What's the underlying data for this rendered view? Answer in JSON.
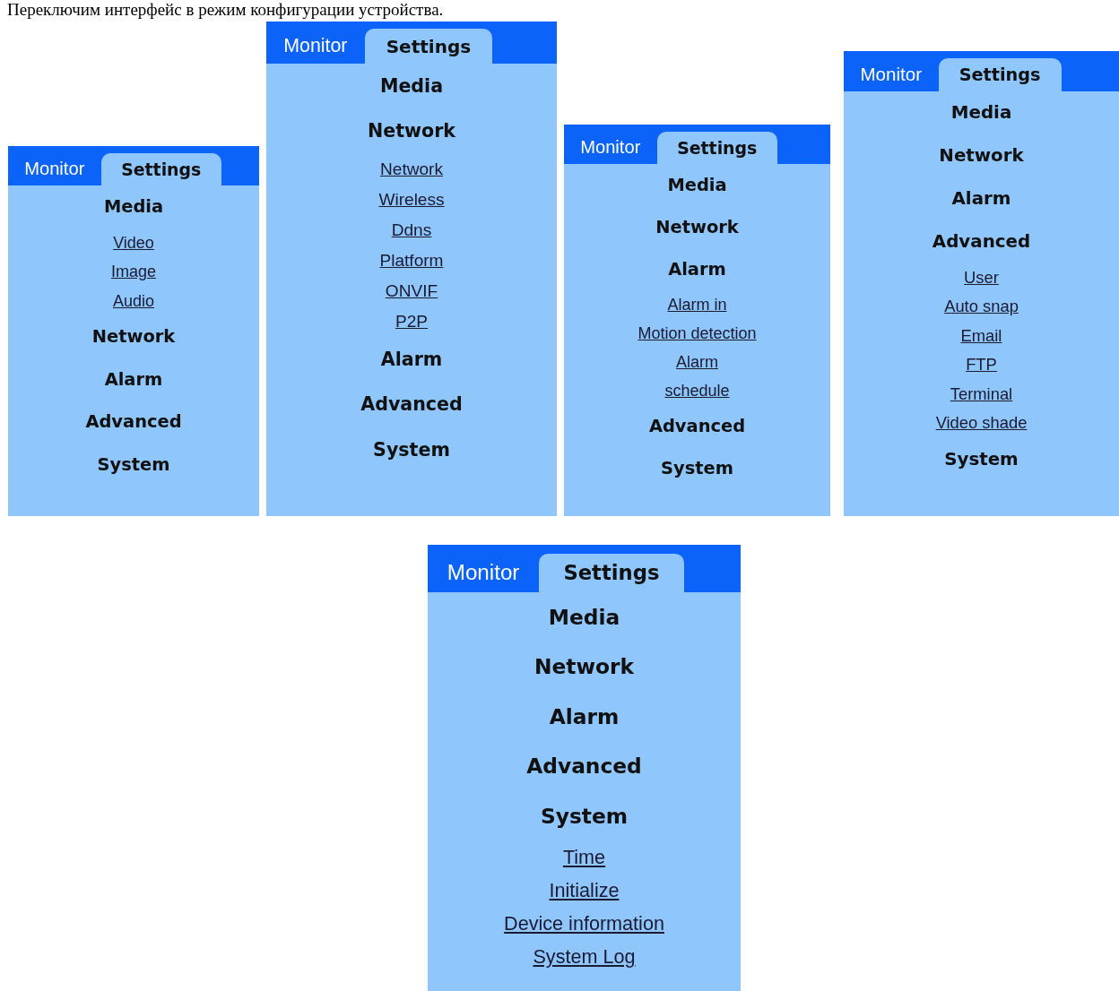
{
  "caption": "Переключим интерфейс в режим конфигурации устройства.",
  "panels": [
    {
      "tabs": [
        {
          "label": "Monitor",
          "selected": false
        },
        {
          "label": "Settings",
          "selected": true
        }
      ],
      "sections": [
        {
          "title": "Media",
          "links": [
            "Video",
            "Image",
            "Audio"
          ]
        },
        {
          "title": "Network"
        },
        {
          "title": "Alarm"
        },
        {
          "title": "Advanced"
        },
        {
          "title": "System"
        }
      ]
    },
    {
      "tabs": [
        {
          "label": "Monitor",
          "selected": false
        },
        {
          "label": "Settings",
          "selected": true
        }
      ],
      "sections": [
        {
          "title": "Media"
        },
        {
          "title": "Network",
          "links": [
            "Network",
            "Wireless",
            "Ddns",
            "Platform",
            "ONVIF",
            "P2P"
          ]
        },
        {
          "title": "Alarm"
        },
        {
          "title": "Advanced"
        },
        {
          "title": "System"
        }
      ]
    },
    {
      "tabs": [
        {
          "label": "Monitor",
          "selected": false
        },
        {
          "label": "Settings",
          "selected": true
        }
      ],
      "sections": [
        {
          "title": "Media"
        },
        {
          "title": "Network"
        },
        {
          "title": "Alarm",
          "links": [
            "Alarm in",
            "Motion detection",
            "Alarm",
            "schedule"
          ]
        },
        {
          "title": "Advanced"
        },
        {
          "title": "System"
        }
      ]
    },
    {
      "tabs": [
        {
          "label": "Monitor",
          "selected": false
        },
        {
          "label": "Settings",
          "selected": true
        }
      ],
      "sections": [
        {
          "title": "Media"
        },
        {
          "title": "Network"
        },
        {
          "title": "Alarm"
        },
        {
          "title": "Advanced",
          "links": [
            "User",
            "Auto snap",
            "Email",
            "FTP",
            "Terminal",
            "Video shade"
          ]
        },
        {
          "title": "System"
        }
      ]
    },
    {
      "tabs": [
        {
          "label": "Monitor",
          "selected": false
        },
        {
          "label": "Settings",
          "selected": true
        }
      ],
      "sections": [
        {
          "title": "Media"
        },
        {
          "title": "Network"
        },
        {
          "title": "Alarm"
        },
        {
          "title": "Advanced"
        },
        {
          "title": "System",
          "links": [
            "Time",
            "Initialize",
            "Device information",
            "System Log"
          ]
        }
      ]
    }
  ]
}
